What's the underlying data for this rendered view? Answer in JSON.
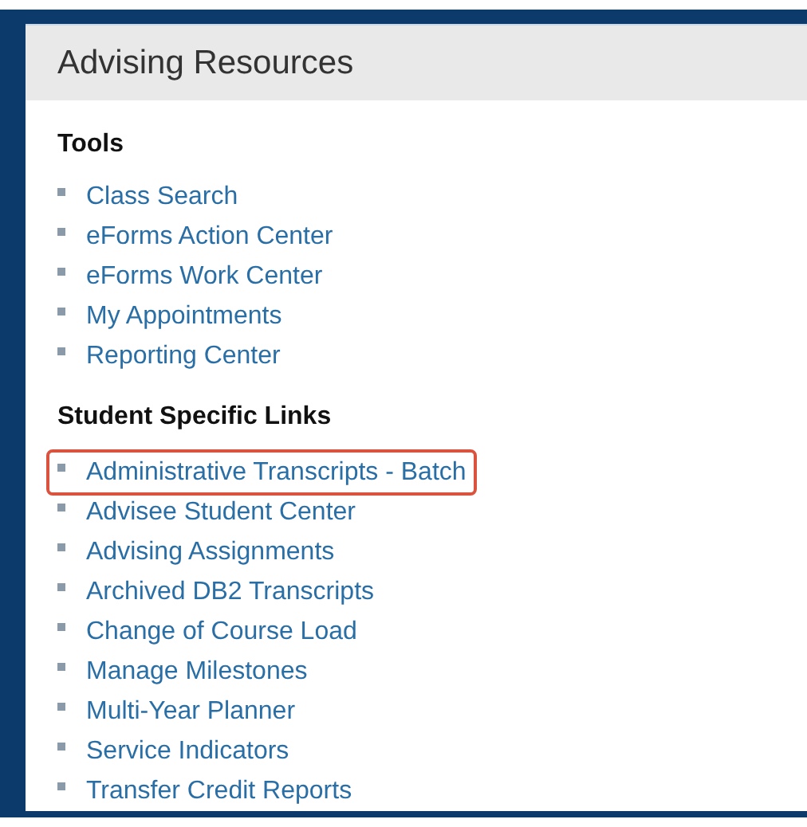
{
  "panel": {
    "title": "Advising Resources"
  },
  "sections": [
    {
      "heading": "Tools",
      "links": [
        {
          "label": "Class Search",
          "highlighted": false
        },
        {
          "label": "eForms Action Center",
          "highlighted": false
        },
        {
          "label": "eForms Work Center",
          "highlighted": false
        },
        {
          "label": "My Appointments",
          "highlighted": false
        },
        {
          "label": "Reporting Center",
          "highlighted": false
        }
      ]
    },
    {
      "heading": "Student Specific Links",
      "links": [
        {
          "label": "Administrative Transcripts - Batch",
          "highlighted": true
        },
        {
          "label": "Advisee Student Center",
          "highlighted": false
        },
        {
          "label": "Advising Assignments",
          "highlighted": false
        },
        {
          "label": "Archived DB2 Transcripts",
          "highlighted": false
        },
        {
          "label": "Change of Course Load",
          "highlighted": false
        },
        {
          "label": "Manage Milestones",
          "highlighted": false
        },
        {
          "label": "Multi-Year Planner",
          "highlighted": false
        },
        {
          "label": "Service Indicators",
          "highlighted": false
        },
        {
          "label": "Transfer Credit Reports",
          "highlighted": false
        }
      ]
    }
  ]
}
